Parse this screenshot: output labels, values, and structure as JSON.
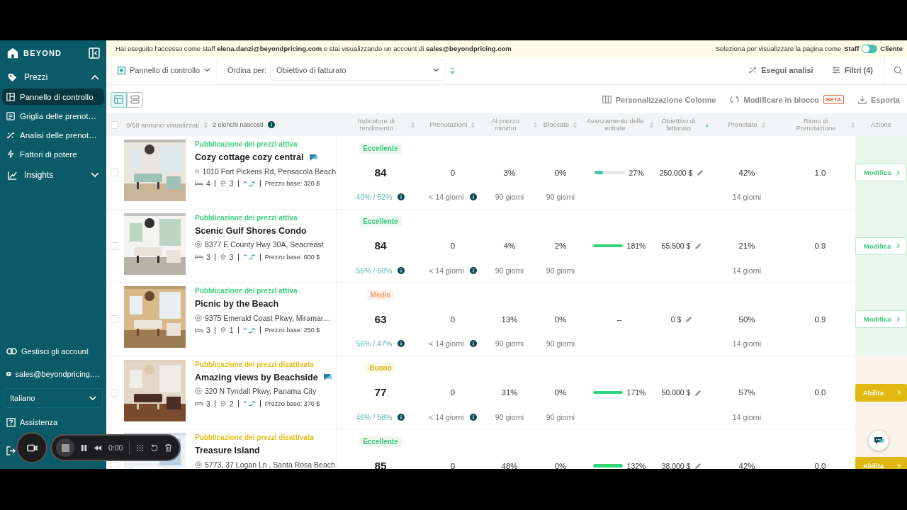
{
  "sidebar": {
    "logo": "BEYOND",
    "items": [
      {
        "label": "Prezzi",
        "expanded": true,
        "children": [
          {
            "label": "Pannello di controllo",
            "selected": true
          },
          {
            "label": "Griglia delle prenot…",
            "selected": false
          },
          {
            "label": "Analisi delle prenot…",
            "selected": false
          },
          {
            "label": "Fattori di potere",
            "selected": false
          }
        ]
      },
      {
        "label": "Insights",
        "expanded": false
      }
    ],
    "footer": [
      {
        "kind": "link",
        "label": "Gestisci gli account"
      },
      {
        "kind": "user",
        "label": "sales@beyondpricing.…"
      }
    ],
    "language": "Italiano",
    "help": "Assistenza"
  },
  "banner": {
    "message": "Hai eseguito l'accesso come staff **elena.danzi@beyondpricing.com** e stai visualizzando un account di **sales@beyondpricing.com**",
    "view_as": "Seleziona per visualizzare la pagina come",
    "staff_label": "Staff",
    "client_label": "Cliente",
    "client_view_on": false
  },
  "toolbar": {
    "dashboard": "Pannello di controllo",
    "sort_label": "Ordina per:",
    "sort_value": "Obiettivo di fatturato",
    "analyze": "Esegui analisi",
    "filters": "Filtri (4)"
  },
  "views": [
    {
      "kind": "table",
      "selected": true
    },
    {
      "kind": "list",
      "selected": false
    }
  ],
  "actions": [
    {
      "kind": "columns",
      "label": "Personalizzazione Colonne"
    },
    {
      "kind": "bulk",
      "label": "Modificare in blocco",
      "badge": "BETA"
    },
    {
      "kind": "export",
      "label": "Esporta"
    }
  ],
  "table": {
    "all_checked": false,
    "summary": "9/68 annunci visualizzati",
    "hidden": "2 elenchi nascosti",
    "columns": [
      {
        "label": "Indicatore di rendimento",
        "sorted": false
      },
      {
        "label": "Prenotazioni",
        "sorted": false
      },
      {
        "label": "Al prezzo minimo",
        "sorted": false
      },
      {
        "label": "Bloccate",
        "sorted": false
      },
      {
        "label": "Avanzamento delle entrate",
        "sorted": false
      },
      {
        "label": "Obiettivo di fatturato",
        "sorted": true
      },
      {
        "label": "Prenotate",
        "sorted": false
      },
      {
        "label": "Ritmo di Prenotazione",
        "sorted": false
      },
      {
        "label": "Azione",
        "sorted": false
      }
    ],
    "rows": [
      {
        "status": "Pubblicazione dei prezzi attiva",
        "publishing": true,
        "title": "Cozy cottage cozy central",
        "flag": true,
        "address": "1010 Fort Pickens Rd, Pensacola Beach",
        "bedrooms": "4",
        "bathrooms": "3",
        "base_price": "Prezzo base: 320 $",
        "rating": {
          "label": "Eccellente",
          "kind": "excellent"
        },
        "score": "84",
        "occupancy": "40% / 52%",
        "bookings": "0",
        "lead_time": "< 14 giorni",
        "min_price": "3%",
        "min_price_window": "90 giorni",
        "blocked": "0%",
        "blocked_window": "90 giorni",
        "revenue": {
          "level": 0.27,
          "reading": "27%"
        },
        "target": "250.000 $",
        "booked": "42%",
        "booked_window": "14 giorni",
        "pace": "1.0",
        "action": {
          "label": "Modifica",
          "kind": "edit"
        },
        "checked": false
      },
      {
        "status": "Pubblicazione dei prezzi attiva",
        "publishing": true,
        "title": "Scenic Gulf Shores Condo",
        "flag": false,
        "address": "8377 E County Hwy 30A, Seacreast",
        "bedrooms": "3",
        "bathrooms": "3",
        "base_price": "Prezzo base: 600 $",
        "rating": {
          "label": "Eccellente",
          "kind": "excellent"
        },
        "score": "84",
        "occupancy": "56% / 50%",
        "bookings": "0",
        "lead_time": "< 14 giorni",
        "min_price": "4%",
        "min_price_window": "90 giorni",
        "blocked": "2%",
        "blocked_window": "90 giorni",
        "revenue": {
          "level": 1,
          "reading": "181%"
        },
        "target": "55.500 $",
        "booked": "21%",
        "booked_window": "14 giorni",
        "pace": "0.9",
        "action": {
          "label": "Modifica",
          "kind": "edit"
        },
        "checked": false
      },
      {
        "status": "Pubblicazione dei prezzi attiva",
        "publishing": true,
        "title": "Picnic by the Beach",
        "flag": false,
        "address": "9375 Emerald Coast Pkwy, Miramar…",
        "bedrooms": "3",
        "bathrooms": "1",
        "base_price": "Prezzo base: 250 $",
        "rating": {
          "label": "Medio",
          "kind": "medium"
        },
        "score": "63",
        "occupancy": "56% / 47%",
        "bookings": "0",
        "lead_time": "< 14 giorni",
        "min_price": "13%",
        "min_price_window": "90 giorni",
        "blocked": "0%",
        "blocked_window": "90 giorni",
        "revenue": {
          "reading": "--"
        },
        "target": "0 $",
        "booked": "50%",
        "booked_window": "14 giorni",
        "pace": "0.9",
        "action": {
          "label": "Modifica",
          "kind": "edit"
        },
        "checked": false
      },
      {
        "status": "Pubblicazione dei prezzi disattivata",
        "publishing": false,
        "title": "Amazing views by Beachside",
        "flag": true,
        "address": "320 N Tyndall Pkwy, Panama City",
        "bedrooms": "3",
        "bathrooms": "2",
        "base_price": "Prezzo base: 370 $",
        "rating": {
          "label": "Buono",
          "kind": "good"
        },
        "score": "77",
        "occupancy": "46% / 58%",
        "bookings": "0",
        "lead_time": "< 14 giorni",
        "min_price": "31%",
        "min_price_window": "90 giorni",
        "blocked": "0%",
        "blocked_window": "90 giorni",
        "revenue": {
          "level": 1,
          "reading": "171%"
        },
        "target": "50.000 $",
        "booked": "57%",
        "booked_window": "14 giorni",
        "pace": "0.0",
        "action": {
          "label": "Abilita",
          "kind": "enable"
        },
        "checked": false
      },
      {
        "status": "Pubblicazione dei prezzi disattivata",
        "publishing": false,
        "title": "Treasure Island",
        "flag": false,
        "address": "5773, 37 Logan Ln , Santa Rosa Beach",
        "rating": {
          "label": "Eccellente",
          "kind": "excellent"
        },
        "score": "85",
        "bookings": "0",
        "min_price": "48%",
        "blocked": "0%",
        "revenue": {
          "level": 1,
          "reading": "132%"
        },
        "target": "38.000 $",
        "booked": "42%",
        "pace": "0.0",
        "action": {
          "label": "Abilita",
          "kind": "enable"
        },
        "checked": false
      }
    ]
  },
  "recorder": {
    "time": "0:00"
  }
}
